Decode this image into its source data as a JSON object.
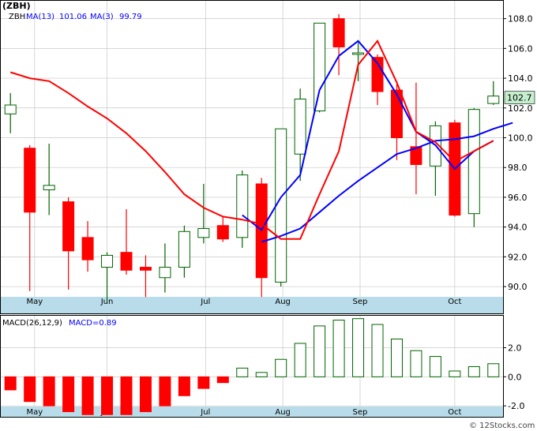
{
  "colors": {
    "up": "#006400",
    "down": "#ff0000",
    "ma13": "#0000ff",
    "ma3": "#ff0000",
    "axis_band": "#b8dcea",
    "grid": "#c8c8c8",
    "price_tag": "#c6efce"
  },
  "chart_data": [
    {
      "type": "candlestick",
      "title": "(ZBH)",
      "legend": [
        {
          "label": "ZBH",
          "color": "#000000"
        },
        {
          "label": "MA(13)",
          "value": "101.06",
          "color": "#0000ff"
        },
        {
          "label": "MA(3)",
          "value": "99.79",
          "color": "#0000ff"
        }
      ],
      "ylim": [
        88.2,
        109.2
      ],
      "yticks": [
        90.0,
        92.0,
        94.0,
        96.0,
        98.0,
        100.0,
        102.0,
        104.0,
        106.0,
        108.0
      ],
      "ytick_labels": [
        "90.0",
        "92.0",
        "94.0",
        "96.0",
        "98.0",
        "100.0",
        "102.0",
        "104.0",
        "106.0",
        "108.0"
      ],
      "last_price": "102.7",
      "last_price_value": 102.7,
      "month_labels": [
        "May",
        "Jun",
        "Jul",
        "Aug",
        "Sep",
        "Oct"
      ],
      "month_positions": [
        1.25,
        5.0,
        10.1,
        14.1,
        18.1,
        23.0
      ],
      "candles": [
        {
          "o": 101.6,
          "h": 103.0,
          "l": 100.3,
          "c": 102.2
        },
        {
          "o": 99.3,
          "h": 99.5,
          "l": 89.7,
          "c": 95.0
        },
        {
          "o": 96.5,
          "h": 99.6,
          "l": 94.8,
          "c": 96.8
        },
        {
          "o": 95.7,
          "h": 96.0,
          "l": 89.8,
          "c": 92.4
        },
        {
          "o": 93.3,
          "h": 94.4,
          "l": 91.0,
          "c": 91.8
        },
        {
          "o": 91.3,
          "h": 92.3,
          "l": 89.0,
          "c": 92.1
        },
        {
          "o": 92.3,
          "h": 95.2,
          "l": 90.8,
          "c": 91.1
        },
        {
          "o": 91.3,
          "h": 92.1,
          "l": 89.3,
          "c": 91.1
        },
        {
          "o": 90.6,
          "h": 92.9,
          "l": 89.6,
          "c": 91.3
        },
        {
          "o": 91.3,
          "h": 94.1,
          "l": 90.6,
          "c": 93.7
        },
        {
          "o": 93.3,
          "h": 96.9,
          "l": 92.9,
          "c": 93.9
        },
        {
          "o": 94.1,
          "h": 94.7,
          "l": 93.0,
          "c": 93.2
        },
        {
          "o": 93.3,
          "h": 97.8,
          "l": 92.6,
          "c": 97.5
        },
        {
          "o": 96.9,
          "h": 97.3,
          "l": 89.3,
          "c": 90.6
        },
        {
          "o": 90.3,
          "h": 100.6,
          "l": 90.0,
          "c": 100.6
        },
        {
          "o": 98.9,
          "h": 103.3,
          "l": 97.1,
          "c": 102.6
        },
        {
          "o": 101.8,
          "h": 107.7,
          "l": 101.7,
          "c": 107.7
        },
        {
          "o": 108.0,
          "h": 108.3,
          "l": 104.2,
          "c": 106.1
        },
        {
          "o": 105.6,
          "h": 106.4,
          "l": 103.8,
          "c": 105.7
        },
        {
          "o": 105.4,
          "h": 105.6,
          "l": 102.2,
          "c": 103.1
        },
        {
          "o": 103.2,
          "h": 103.6,
          "l": 98.5,
          "c": 100.0
        },
        {
          "o": 99.4,
          "h": 103.7,
          "l": 96.2,
          "c": 98.2
        },
        {
          "o": 98.1,
          "h": 101.1,
          "l": 96.1,
          "c": 100.8
        },
        {
          "o": 101.0,
          "h": 101.2,
          "l": 94.7,
          "c": 94.8
        },
        {
          "o": 94.9,
          "h": 102.0,
          "l": 94.0,
          "c": 101.9
        },
        {
          "o": 102.3,
          "h": 103.8,
          "l": 102.2,
          "c": 102.8
        }
      ],
      "series": [
        {
          "name": "MA(13)",
          "color": "#0000ff",
          "start_index": 13,
          "values": [
            93.0,
            93.4,
            93.9,
            95.0,
            96.1,
            97.1,
            98.0,
            98.9,
            99.3,
            99.8,
            99.9,
            100.1,
            100.6,
            101.0
          ]
        },
        {
          "name": "MA(3)",
          "color": "#0000ff",
          "start_index": 12,
          "values": [
            94.8,
            93.8,
            96.0,
            97.5,
            103.2,
            105.5,
            106.5,
            105.0,
            102.9,
            100.4,
            99.5,
            97.9,
            99.1,
            99.8
          ]
        },
        {
          "name": "MA",
          "color": "#ff0000",
          "start_index": 0,
          "values": [
            104.4,
            104.0,
            103.8,
            103.0,
            102.1,
            101.3,
            100.3,
            99.1,
            97.7,
            96.2,
            95.3,
            94.7,
            94.5,
            94.2,
            93.2,
            93.2,
            96.2,
            99.1,
            104.9,
            106.5,
            103.7,
            100.4,
            99.7,
            98.4,
            99.1,
            99.8
          ]
        }
      ],
      "xlim": [
        -0.5,
        25.5
      ]
    },
    {
      "type": "bar",
      "title": "MACD(26,12,9)",
      "legend": [
        {
          "label": "MACD(26,12,9)",
          "color": "#000000"
        },
        {
          "label": "MACD=0.89",
          "color": "#0000ff"
        }
      ],
      "ylim": [
        -2.75,
        4.2
      ],
      "yticks": [
        -2.0,
        0.0,
        2.0
      ],
      "ytick_labels": [
        "-2.0",
        "0.0",
        "2.0"
      ],
      "month_labels": [
        "May",
        "Jun",
        "Jul",
        "Aug",
        "Sep",
        "Oct"
      ],
      "values": [
        -0.9,
        -1.7,
        -2.0,
        -2.4,
        -2.6,
        -2.6,
        -2.6,
        -2.4,
        -2.0,
        -1.3,
        -0.8,
        -0.4,
        0.6,
        0.3,
        1.2,
        2.3,
        3.5,
        3.9,
        4.0,
        3.6,
        2.6,
        1.8,
        1.4,
        0.4,
        0.7,
        0.9
      ]
    }
  ],
  "footer": {
    "copyright": "© 12Stocks.com"
  }
}
